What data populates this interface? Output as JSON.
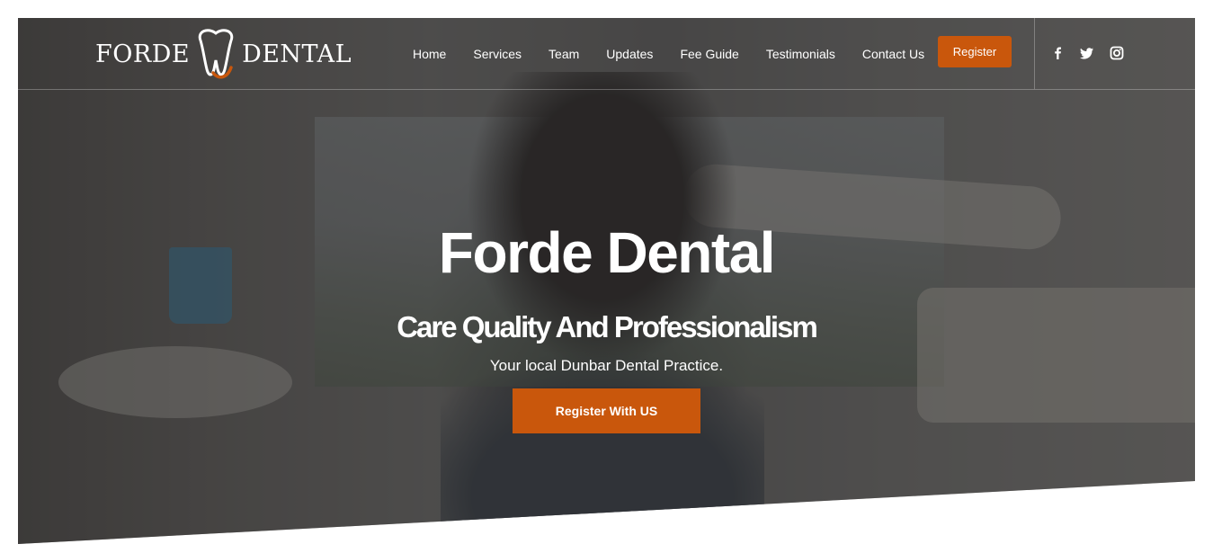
{
  "brand": {
    "left_word": "FORDE",
    "right_word": "DENTAL",
    "logo_icon": "tooth-icon",
    "accent_color": "#c9570c"
  },
  "nav": {
    "items": [
      {
        "label": "Home"
      },
      {
        "label": "Services"
      },
      {
        "label": "Team"
      },
      {
        "label": "Updates"
      },
      {
        "label": "Fee Guide"
      },
      {
        "label": "Testimonials"
      },
      {
        "label": "Contact Us"
      }
    ],
    "register_label": "Register"
  },
  "social": [
    {
      "icon": "facebook-icon"
    },
    {
      "icon": "twitter-icon"
    },
    {
      "icon": "instagram-icon"
    }
  ],
  "hero": {
    "title": "Forde Dental",
    "subtitle": "Care Quality And Professionalism",
    "tagline": "Your local Dunbar Dental Practice.",
    "cta_label": "Register With US"
  }
}
